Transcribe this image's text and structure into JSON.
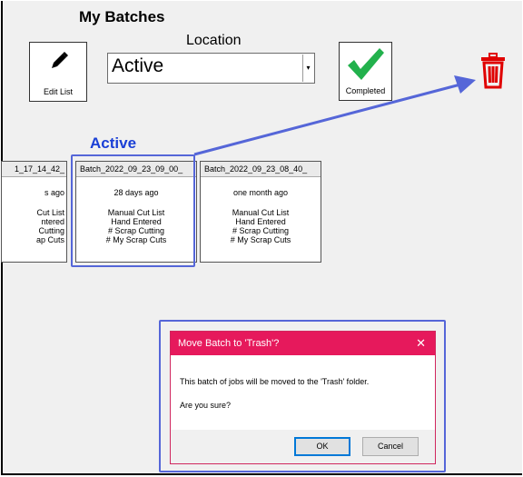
{
  "header": {
    "title": "My Batches",
    "location_label": "Location"
  },
  "toolbar": {
    "edit_label": "Edit List",
    "completed_label": "Completed"
  },
  "location_select": {
    "value": "Active"
  },
  "section": {
    "heading": "Active"
  },
  "batches": [
    {
      "name": "1_17_14_42_",
      "age": "s ago",
      "lines": [
        "Cut List",
        "ntered",
        "Cutting",
        "ap Cuts"
      ]
    },
    {
      "name": "Batch_2022_09_23_09_00_",
      "age": "28 days ago",
      "lines": [
        "Manual Cut List",
        "Hand Entered",
        "# Scrap Cutting",
        "# My Scrap Cuts"
      ]
    },
    {
      "name": "Batch_2022_09_23_08_40_",
      "age": "one month ago",
      "lines": [
        "Manual Cut List",
        "Hand Entered",
        "# Scrap Cutting",
        "# My Scrap Cuts"
      ]
    }
  ],
  "dialog": {
    "title": "Move Batch to 'Trash'?",
    "message": "This batch of jobs will be moved to the 'Trash' folder.",
    "question": "Are you sure?",
    "ok_label": "OK",
    "cancel_label": "Cancel"
  },
  "colors": {
    "accent": "#1a3fd6",
    "dialog_bar": "#e6195c",
    "trash": "#e00000",
    "check": "#22b14c",
    "highlight": "#5566d8"
  }
}
